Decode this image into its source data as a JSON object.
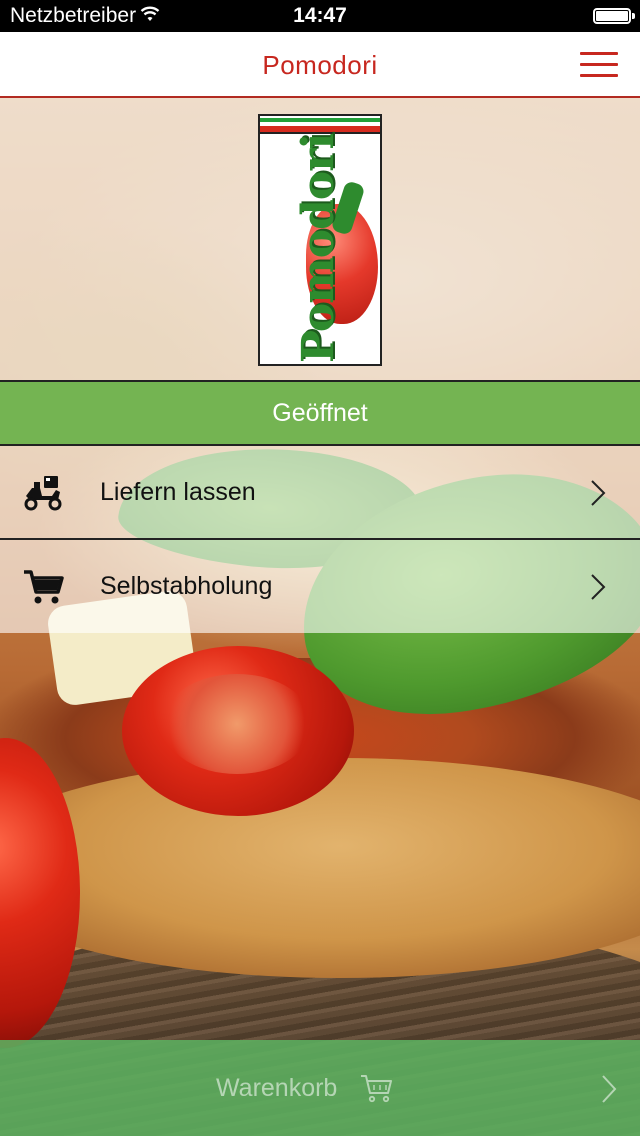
{
  "status_bar": {
    "carrier": "Netzbetreiber",
    "time": "14:47",
    "battery_level": 1.0,
    "wifi_icon": "wifi-icon"
  },
  "nav": {
    "title": "Pomodori",
    "menu_icon": "hamburger-menu-icon",
    "accent_color": "#c7271f"
  },
  "logo": {
    "text": "Pomodori"
  },
  "open_status": {
    "label": "Geöffnet",
    "color": "#74b452"
  },
  "options": [
    {
      "label": "Liefern lassen",
      "icon": "delivery-scooter-icon"
    },
    {
      "label": "Selbstabholung",
      "icon": "shopping-cart-icon"
    }
  ],
  "cart": {
    "label": "Warenkorb",
    "icon": "shopping-cart-icon",
    "color": "#5cb060"
  }
}
